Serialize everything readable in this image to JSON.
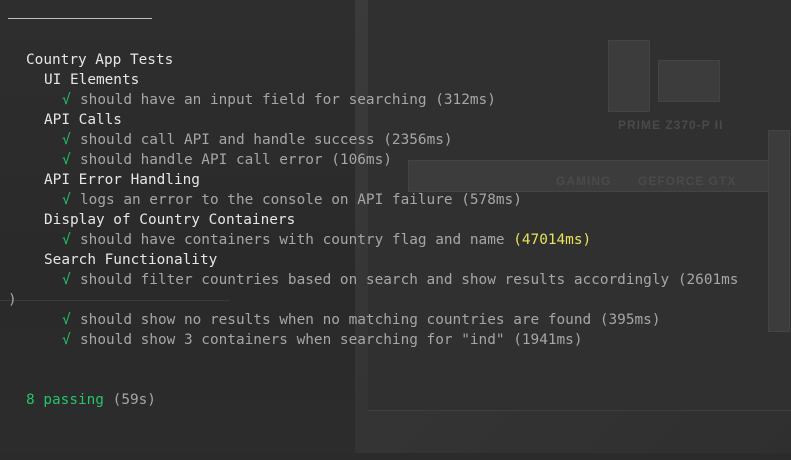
{
  "suite": {
    "title": "Country App Tests",
    "groups": [
      {
        "name": "UI Elements",
        "tests": [
          {
            "check": "√",
            "text": "should have an input field for searching",
            "duration": "(312ms)"
          }
        ]
      },
      {
        "name": "API Calls",
        "tests": [
          {
            "check": "√",
            "text": "should call API and handle success",
            "duration": "(2356ms)"
          },
          {
            "check": "√",
            "text": "should handle API call error",
            "duration": "(106ms)"
          }
        ]
      },
      {
        "name": "API Error Handling",
        "tests": [
          {
            "check": "√",
            "text": "logs an error to the console on API failure",
            "duration": "(578ms)"
          }
        ]
      },
      {
        "name": "Display of Country Containers",
        "tests": [
          {
            "check": "√",
            "text": "should have containers with country flag and name",
            "duration": "(47014ms)"
          }
        ]
      },
      {
        "name": "Search Functionality",
        "tests": [
          {
            "check": "√",
            "text": "should filter countries based on search and show results accordingly",
            "duration": "(2601ms",
            "wrap": ")"
          },
          {
            "check": "√",
            "text": "should show no results when no matching countries are found",
            "duration": "(395ms)"
          },
          {
            "check": "√",
            "text": "should show 3 containers when searching for \"ind\"",
            "duration": "(1941ms)"
          }
        ]
      }
    ]
  },
  "summary": {
    "passing": "8 passing",
    "time": "(59s)"
  },
  "colors": {
    "pass": "#23c46b",
    "slow": "#e8e35a",
    "text": "#e6e6e6",
    "muted": "#a6a6a6"
  },
  "background": {
    "board_labels": [
      "PRIME Z370-P II",
      "GAMING",
      "GEFORCE GTX"
    ]
  }
}
